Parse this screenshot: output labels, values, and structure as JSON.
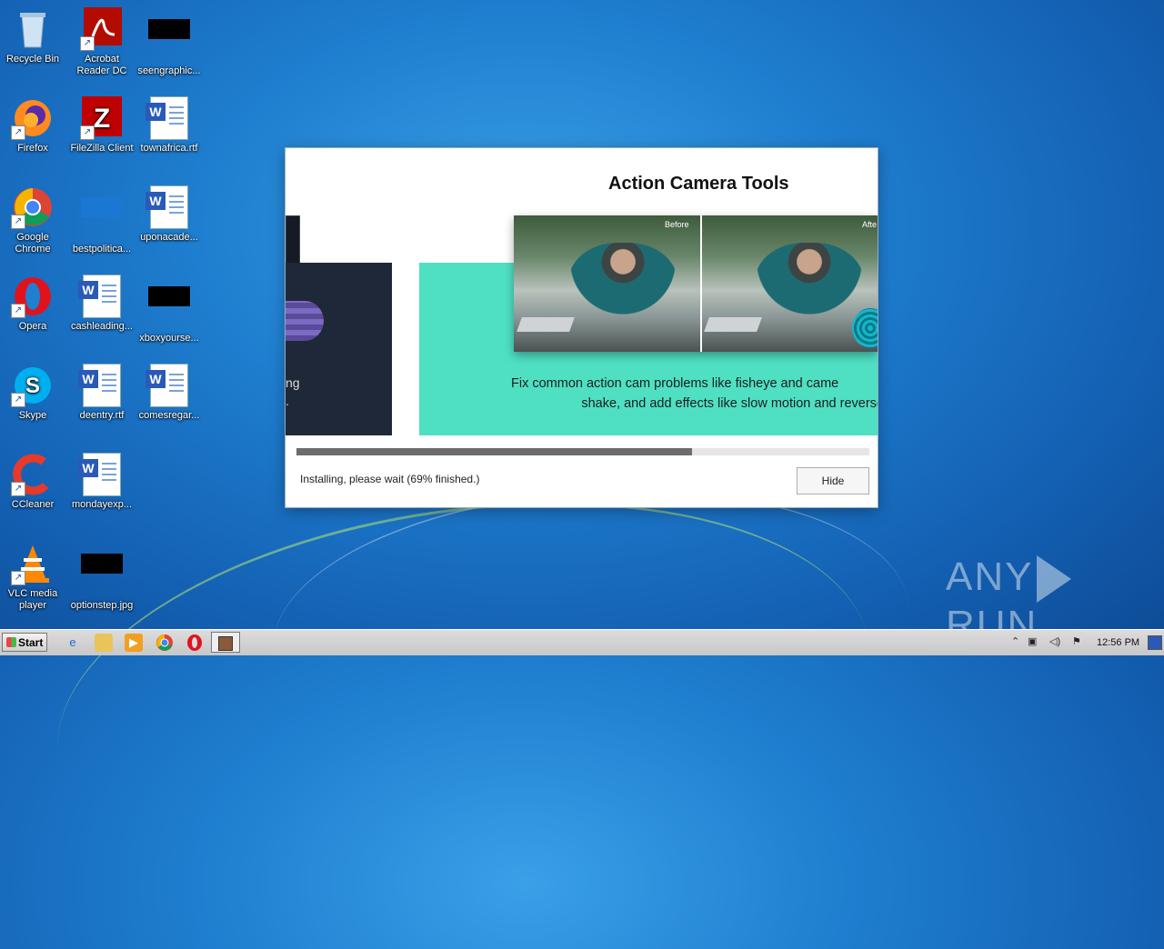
{
  "desktop": {
    "icons": [
      {
        "label": "Recycle Bin"
      },
      {
        "label": "Acrobat Reader DC"
      },
      {
        "label": "seengraphic..."
      },
      {
        "label": "Firefox"
      },
      {
        "label": "FileZilla Client"
      },
      {
        "label": "townafrica.rtf"
      },
      {
        "label": "Google Chrome"
      },
      {
        "label": "bestpolitica..."
      },
      {
        "label": "uponacade..."
      },
      {
        "label": "Opera"
      },
      {
        "label": "cashleading..."
      },
      {
        "label": "xboxyourse..."
      },
      {
        "label": "Skype"
      },
      {
        "label": "deentry.rtf"
      },
      {
        "label": "comesregar..."
      },
      {
        "label": "CCleaner"
      },
      {
        "label": "mondayexp..."
      },
      {
        "label": "VLC media player"
      },
      {
        "label": "optionstep.jpg"
      }
    ]
  },
  "installer": {
    "title": "Action Camera Tools",
    "left_panel_text": [
      "ng",
      "."
    ],
    "photo_labels": {
      "before": "Before",
      "after": "Afte"
    },
    "description": [
      "Fix common action cam problems like fisheye and came",
      "shake, and add effects like slow motion and reverse."
    ],
    "progress_percent": 69,
    "status_text": "Installing, please wait (69% finished.)",
    "hide_label": "Hide",
    "colors": {
      "teal_panel": "#4fe0c4",
      "dark_panel": "#1f2838",
      "progress_fill": "#6d6d6d"
    }
  },
  "watermark": {
    "left": "ANY",
    "right": "RUN"
  },
  "taskbar": {
    "start_label": "Start",
    "pinned": [
      "internet-explorer-icon",
      "explorer-folder-icon",
      "media-player-icon",
      "chrome-icon",
      "opera-icon",
      "installer-app-icon"
    ],
    "tray_icons": [
      "show-hidden-icons",
      "network-icon",
      "volume-icon",
      "action-center-flag-icon"
    ],
    "clock": "12:56 PM"
  }
}
